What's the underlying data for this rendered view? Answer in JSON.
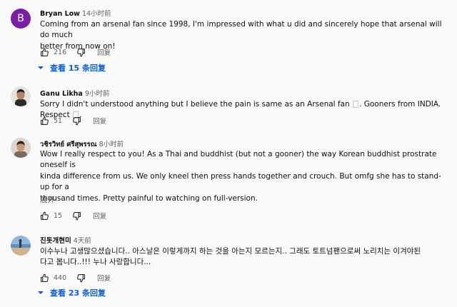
{
  "comments": [
    {
      "avatar_letter": "B",
      "avatar_color": "#7b1fa2",
      "author": "Bryan Low",
      "time": "14小时前",
      "text_lines": [
        "Coming from an arsenal fan since 1998, I'm impressed with what u did and sincerely hope that arsenal will do much",
        "better from now on!"
      ],
      "likes": "216",
      "reply_label": "回复",
      "view_replies": "查看 15 条回复"
    },
    {
      "avatar_type": "photo",
      "author": "Ganu Likha",
      "time": "9小时前",
      "text_a": "Sorry I didn't understood anything but I believe the pain is same as an Arsenal fan",
      "text_b": ".  Gooners from INDIA. Respect",
      "text_c": ".",
      "likes": "51",
      "reply_label": "回复"
    },
    {
      "avatar_type": "photo",
      "author": "วชิรวิทย์ ศรีสุพรรณ",
      "time": "8小时前",
      "text_lines": [
        "Wow I really respect to you! As a Thai and buddhist (but not a gooner) the way Korean buddhist prostrate oneself is",
        "kinda difference from us. We only kneel then press hands together and crouch. But omfg she has to stand-up for a",
        "thousand times. Pretty painful to watching on full-version."
      ],
      "ellipsis": "...",
      "expand_label": "展开",
      "likes": "15",
      "reply_label": "回复"
    },
    {
      "avatar_type": "photo",
      "author": "진돗개현미",
      "time": "4天前",
      "text_lines": [
        "이수누나 고생많으셨습니다.. 아스날은 이렇게까지 하는 것을 아는지 모르는지.. 그래도 토트넘팬으로써 노리치는 이겨야된",
        "다고 봅니다..!!! 누나 사랑합니다..."
      ],
      "likes": "440",
      "reply_label": "回复",
      "view_replies": "查看 23 条回复"
    }
  ],
  "colors": {
    "background": "#f9f9f9",
    "link": "#065fd4",
    "muted": "#606060"
  },
  "icons": [
    "thumbs-up-icon",
    "thumbs-down-icon",
    "chevron-down-icon",
    "placeholder-glyph-icon"
  ]
}
